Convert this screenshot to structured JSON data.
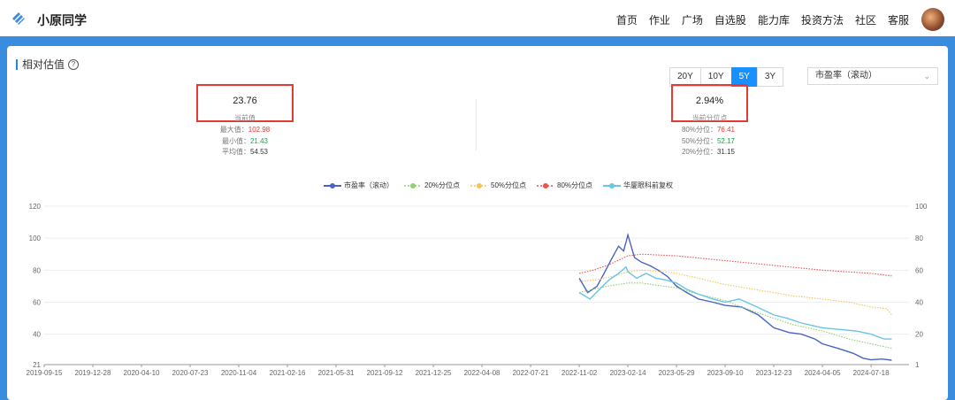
{
  "header": {
    "brand": "小原同学",
    "nav": [
      "首页",
      "作业",
      "广场",
      "自选股",
      "能力库",
      "投资方法",
      "社区",
      "客服"
    ]
  },
  "section": {
    "title": "相对估值",
    "help": "?"
  },
  "controls": {
    "ranges": [
      "20Y",
      "10Y",
      "5Y",
      "3Y"
    ],
    "active_range": "5Y",
    "metric": "市盈率（滚动）",
    "chevron": "⌄"
  },
  "left_stat": {
    "value": "23.76",
    "label": "当前值",
    "rows": [
      {
        "label": "最大值：",
        "value": "102.98"
      },
      {
        "label": "最小值：",
        "value": "21.43"
      },
      {
        "label": "平均值：",
        "value": "54.53"
      }
    ]
  },
  "right_stat": {
    "value": "2.94%",
    "label": "当前分位点",
    "rows": [
      {
        "label": "80%分位：",
        "value": "76.41"
      },
      {
        "label": "50%分位：",
        "value": "52.17"
      },
      {
        "label": "20%分位：",
        "value": "31.15"
      }
    ]
  },
  "colors": {
    "pe": "#4a62c4",
    "p20": "#8fd16a",
    "p50": "#f6c453",
    "p80": "#e9534f",
    "price": "#6ac4e6"
  },
  "chart_data": {
    "type": "line",
    "x_ticks": [
      "2019-09-15",
      "2019-12-28",
      "2020-04-10",
      "2020-07-23",
      "2020-11-04",
      "2021-02-16",
      "2021-05-31",
      "2021-09-12",
      "2021-12-25",
      "2022-04-08",
      "2022-07-21",
      "2022-11-02",
      "2023-02-14",
      "2023-05-29",
      "2023-09-10",
      "2023-12-23",
      "2024-04-05",
      "2024-07-18"
    ],
    "y_left": {
      "ticks": [
        21,
        40,
        60,
        80,
        100,
        120
      ],
      "range": [
        21,
        120
      ]
    },
    "y_right": {
      "ticks": [
        1,
        20,
        40,
        60,
        80,
        100
      ],
      "range": [
        1,
        100
      ]
    },
    "series": [
      {
        "name": "市盈率（滚动）",
        "axis": "left",
        "style": "solid",
        "points": [
          [
            "2022-11-02",
            75
          ],
          [
            "2022-11-20",
            66
          ],
          [
            "2022-12-10",
            70
          ],
          [
            "2022-12-25",
            78
          ],
          [
            "2023-01-10",
            87
          ],
          [
            "2023-01-25",
            95
          ],
          [
            "2023-02-05",
            92
          ],
          [
            "2023-02-14",
            102
          ],
          [
            "2023-02-28",
            88
          ],
          [
            "2023-03-15",
            85
          ],
          [
            "2023-04-01",
            83
          ],
          [
            "2023-04-20",
            80
          ],
          [
            "2023-05-10",
            76
          ],
          [
            "2023-05-29",
            70
          ],
          [
            "2023-06-20",
            66
          ],
          [
            "2023-07-15",
            62
          ],
          [
            "2023-08-15",
            60
          ],
          [
            "2023-09-10",
            58
          ],
          [
            "2023-10-15",
            57
          ],
          [
            "2023-11-20",
            52
          ],
          [
            "2023-12-23",
            44
          ],
          [
            "2024-01-25",
            41
          ],
          [
            "2024-02-20",
            40
          ],
          [
            "2024-03-20",
            37
          ],
          [
            "2024-04-05",
            34
          ],
          [
            "2024-05-10",
            31
          ],
          [
            "2024-06-10",
            28
          ],
          [
            "2024-07-01",
            25
          ],
          [
            "2024-07-18",
            24
          ],
          [
            "2024-08-10",
            24.5
          ],
          [
            "2024-08-31",
            23.76
          ]
        ]
      },
      {
        "name": "20%分位点",
        "axis": "left",
        "style": "dotted",
        "points": [
          [
            "2022-11-02",
            66
          ],
          [
            "2022-12-01",
            68
          ],
          [
            "2023-01-01",
            70
          ],
          [
            "2023-02-14",
            72
          ],
          [
            "2023-03-15",
            72
          ],
          [
            "2023-05-01",
            70
          ],
          [
            "2023-05-29",
            69
          ],
          [
            "2023-07-01",
            66
          ],
          [
            "2023-09-10",
            61
          ],
          [
            "2023-10-15",
            57
          ],
          [
            "2023-12-23",
            50
          ],
          [
            "2024-02-01",
            46
          ],
          [
            "2024-04-05",
            42
          ],
          [
            "2024-06-01",
            37
          ],
          [
            "2024-07-18",
            34
          ],
          [
            "2024-08-31",
            31.15
          ]
        ]
      },
      {
        "name": "50%分位点",
        "axis": "left",
        "style": "dotted",
        "points": [
          [
            "2022-11-02",
            73
          ],
          [
            "2022-12-10",
            74
          ],
          [
            "2023-01-10",
            76
          ],
          [
            "2023-02-14",
            79
          ],
          [
            "2023-03-15",
            80
          ],
          [
            "2023-05-01",
            79
          ],
          [
            "2023-05-29",
            78
          ],
          [
            "2023-07-15",
            75
          ],
          [
            "2023-09-10",
            71
          ],
          [
            "2023-12-23",
            66
          ],
          [
            "2024-02-01",
            64
          ],
          [
            "2024-04-05",
            62
          ],
          [
            "2024-06-01",
            60
          ],
          [
            "2024-07-18",
            57
          ],
          [
            "2024-08-20",
            56
          ],
          [
            "2024-08-31",
            52.17
          ]
        ]
      },
      {
        "name": "80%分位点",
        "axis": "left",
        "style": "dotted",
        "points": [
          [
            "2022-11-02",
            78
          ],
          [
            "2022-12-01",
            80
          ],
          [
            "2023-01-01",
            83
          ],
          [
            "2023-02-14",
            89
          ],
          [
            "2023-03-15",
            90
          ],
          [
            "2023-05-29",
            89
          ],
          [
            "2023-09-10",
            86
          ],
          [
            "2023-12-23",
            83
          ],
          [
            "2024-04-05",
            80
          ],
          [
            "2024-07-18",
            78
          ],
          [
            "2024-08-31",
            76.41
          ]
        ]
      },
      {
        "name": "华厦眼科前复权",
        "axis": "right",
        "style": "solid",
        "points": [
          [
            "2022-11-02",
            46
          ],
          [
            "2022-11-25",
            42
          ],
          [
            "2022-12-15",
            48
          ],
          [
            "2023-01-05",
            54
          ],
          [
            "2023-01-25",
            58
          ],
          [
            "2023-02-10",
            62
          ],
          [
            "2023-02-14",
            59
          ],
          [
            "2023-03-05",
            55
          ],
          [
            "2023-03-25",
            58
          ],
          [
            "2023-04-15",
            55
          ],
          [
            "2023-05-05",
            54
          ],
          [
            "2023-05-29",
            52
          ],
          [
            "2023-06-20",
            48
          ],
          [
            "2023-07-15",
            45
          ],
          [
            "2023-08-15",
            42
          ],
          [
            "2023-09-10",
            40
          ],
          [
            "2023-10-10",
            42
          ],
          [
            "2023-11-10",
            38
          ],
          [
            "2023-12-23",
            32
          ],
          [
            "2024-01-20",
            30
          ],
          [
            "2024-02-20",
            27
          ],
          [
            "2024-04-05",
            24
          ],
          [
            "2024-05-10",
            23
          ],
          [
            "2024-06-15",
            22
          ],
          [
            "2024-07-18",
            20
          ],
          [
            "2024-08-15",
            17
          ],
          [
            "2024-08-31",
            17
          ]
        ]
      }
    ]
  }
}
